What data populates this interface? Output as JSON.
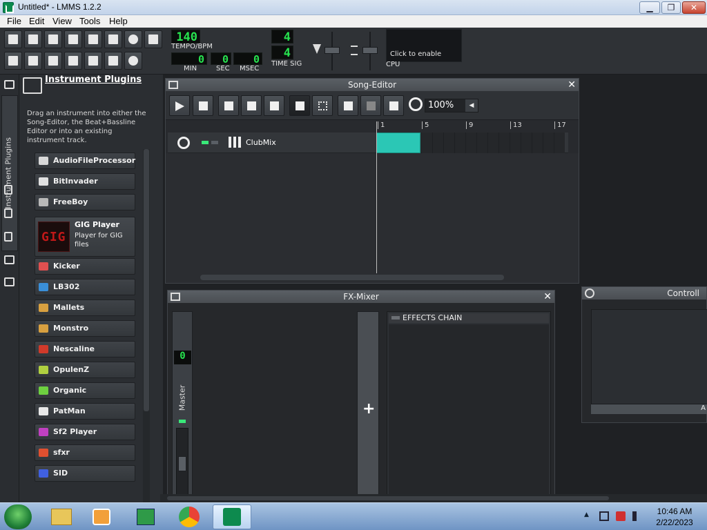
{
  "window": {
    "title": "Untitled* - LMMS 1.2.2",
    "controls": [
      "▁",
      "❐",
      "✕"
    ]
  },
  "menu": [
    "File",
    "Edit",
    "View",
    "Tools",
    "Help"
  ],
  "transport": {
    "tempo": "140",
    "tempo_label": "TEMPO/BPM",
    "min": "0",
    "sec": "0",
    "msec": "0",
    "min_label": "MIN",
    "sec_label": "SEC",
    "msec_label": "MSEC",
    "timesig_num": "4",
    "timesig_den": "4",
    "timesig_label": "TIME SIG",
    "cpu_hint": "Click to enable",
    "cpu_label": "CPU"
  },
  "sidebar": {
    "tab_label": "Instrument Plugins",
    "title": "Instrument Plugins",
    "description": "Drag an instrument into either the Song-Editor, the Beat+Bassline Editor or into an existing instrument track.",
    "plugins": [
      {
        "name": "AudioFileProcessor",
        "icon": "note-icon",
        "color": "#d8d8d8"
      },
      {
        "name": "BitInvader",
        "icon": "invader-icon",
        "color": "#e0e0e0"
      },
      {
        "name": "FreeBoy",
        "icon": "gameboy-icon",
        "color": "#b8b8b8"
      },
      {
        "name": "Kicker",
        "icon": "kicker-icon",
        "color": "#e05050"
      },
      {
        "name": "LB302",
        "icon": "lb302-icon",
        "color": "#3a8fd8"
      },
      {
        "name": "Mallets",
        "icon": "mallets-icon",
        "color": "#d8a040"
      },
      {
        "name": "Monstro",
        "icon": "monstro-icon",
        "color": "#d8a040"
      },
      {
        "name": "Nescaline",
        "icon": "nescaline-icon",
        "color": "#d03a2a"
      },
      {
        "name": "OpulenZ",
        "icon": "opulenz-icon",
        "color": "#b0d040"
      },
      {
        "name": "Organic",
        "icon": "organic-icon",
        "color": "#6ed040"
      },
      {
        "name": "PatMan",
        "icon": "patman-icon",
        "color": "#e8e8e8"
      },
      {
        "name": "Sf2 Player",
        "icon": "sf2-icon",
        "color": "#c040c0"
      },
      {
        "name": "sfxr",
        "icon": "sfxr-icon",
        "color": "#e05030"
      },
      {
        "name": "SID",
        "icon": "sid-icon",
        "color": "#4060e0"
      }
    ],
    "gig": {
      "name": "GIG Player",
      "desc": "Player for GIG files",
      "logo": "GIG"
    }
  },
  "song_editor": {
    "title": "Song-Editor",
    "zoom": "100%",
    "bars": [
      "1",
      "5",
      "9",
      "13",
      "17"
    ],
    "track_name": "ClubMix",
    "clip_color": "#2bc7b5"
  },
  "fx_mixer": {
    "title": "FX-Mixer",
    "master_value": "0",
    "master_label": "Master",
    "add_label": "+",
    "chain_label": "EFFECTS CHAIN"
  },
  "controller_rack": {
    "title": "Controll",
    "add_label": "A"
  },
  "taskbar": {
    "time": "10:46 AM",
    "date": "2/22/2023"
  }
}
